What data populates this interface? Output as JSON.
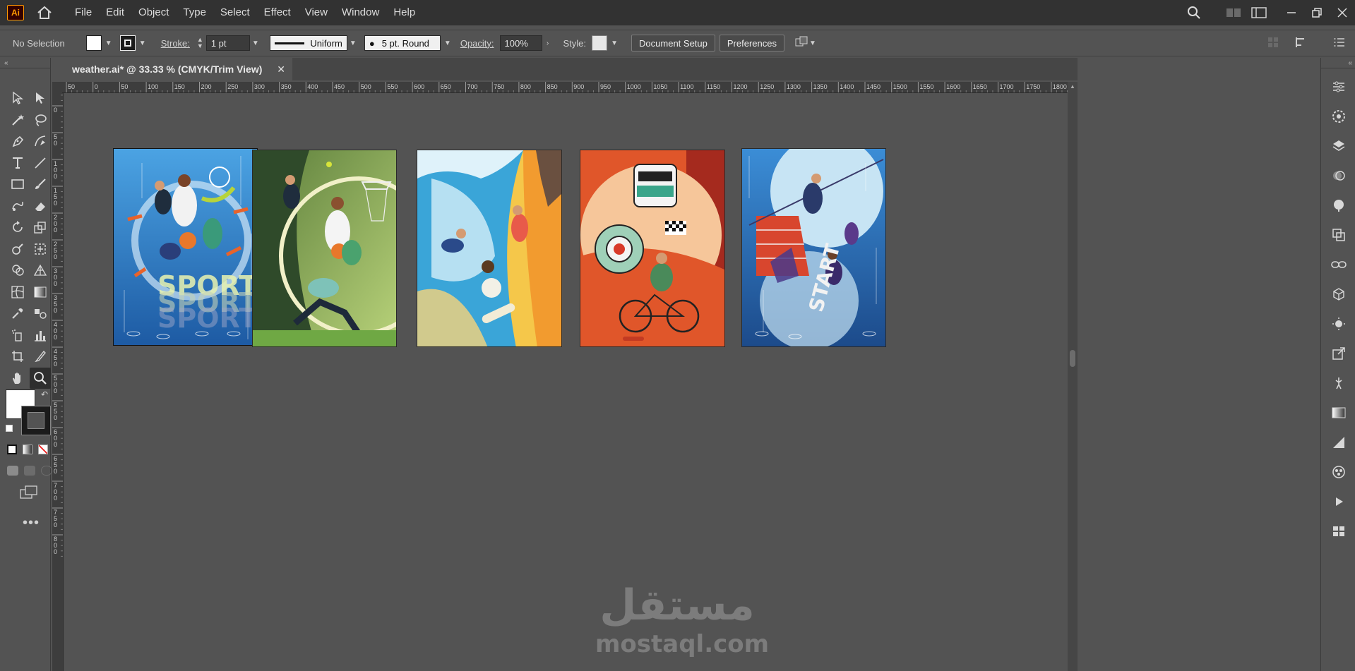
{
  "app": {
    "logo_text": "Ai",
    "menus": [
      "File",
      "Edit",
      "Object",
      "Type",
      "Select",
      "Effect",
      "View",
      "Window",
      "Help"
    ]
  },
  "control_bar": {
    "selection_status": "No Selection",
    "stroke_label": "Stroke:",
    "stroke_value": "1 pt",
    "stroke_profile": "Uniform",
    "brush_value": "5 pt. Round",
    "opacity_label": "Opacity:",
    "opacity_value": "100%",
    "style_label": "Style:",
    "document_setup": "Document Setup",
    "preferences": "Preferences"
  },
  "document_tab": {
    "title": "weather.ai* @ 33.33 % (CMYK/Trim View)",
    "close": "✕"
  },
  "rulers": {
    "horizontal_labels": [
      "50",
      "0",
      "50",
      "100",
      "150",
      "200",
      "250",
      "300",
      "350",
      "400",
      "450",
      "500",
      "550",
      "600",
      "650",
      "700",
      "750",
      "800",
      "850",
      "900",
      "950",
      "1000",
      "1050",
      "1100",
      "1150",
      "1200",
      "1250",
      "1300",
      "1350",
      "1400",
      "1450",
      "1500",
      "1550",
      "1600",
      "1650",
      "1700",
      "1750",
      "1800"
    ],
    "vertical_labels": [
      "50",
      "0",
      "50",
      "100",
      "150",
      "200",
      "250",
      "300",
      "350",
      "400",
      "450",
      "500",
      "550",
      "600",
      "650",
      "700",
      "750",
      "800"
    ]
  },
  "artboards": [
    {
      "name": "artboard-sport",
      "text": "SPORT",
      "colors": [
        "#3a8fd6",
        "#1f5fa8",
        "#f2f2f2"
      ]
    },
    {
      "name": "artboard-basketball",
      "text": "",
      "colors": [
        "#9dc85c",
        "#3d5a2a",
        "#e86a2b"
      ]
    },
    {
      "name": "artboard-surf-climb",
      "text": "",
      "colors": [
        "#3aa5d8",
        "#f5c74a",
        "#f29b2f"
      ]
    },
    {
      "name": "artboard-rally-cycling",
      "text": "",
      "colors": [
        "#e0562a",
        "#a52a1e",
        "#f6c69a"
      ]
    },
    {
      "name": "artboard-athletics",
      "text": "START",
      "colors": [
        "#2e7fc6",
        "#1c4a8a",
        "#c7e4f4"
      ]
    }
  ],
  "watermark": {
    "arabic": "مستقل",
    "latin": "mostaql.com"
  }
}
